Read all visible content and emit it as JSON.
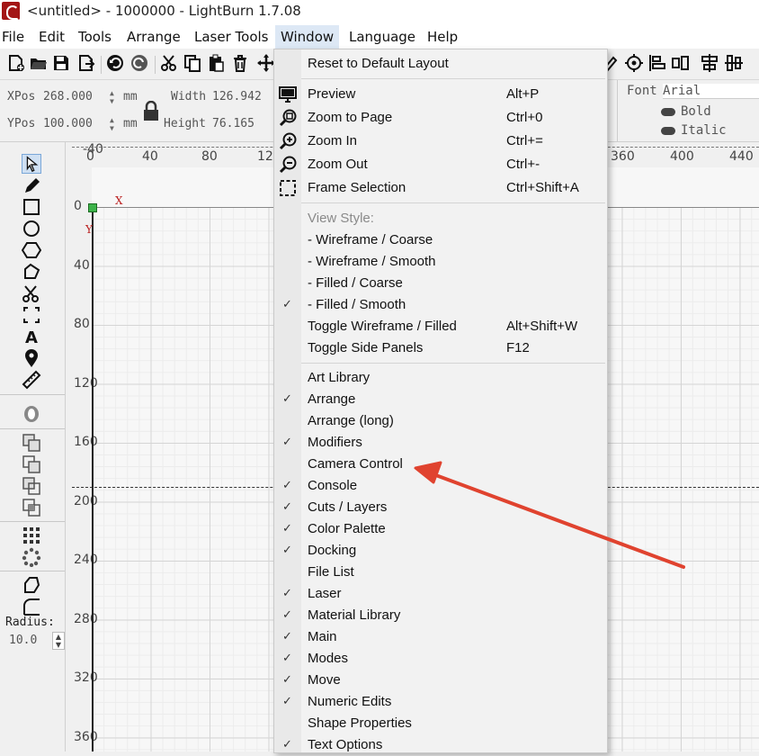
{
  "window": {
    "title": "<untitled> - 1000000 - LightBurn 1.7.08"
  },
  "menubar": [
    {
      "label": "File"
    },
    {
      "label": "Edit"
    },
    {
      "label": "Tools"
    },
    {
      "label": "Arrange"
    },
    {
      "label": "Laser Tools"
    },
    {
      "label": "Window"
    },
    {
      "label": "Language"
    },
    {
      "label": "Help"
    }
  ],
  "numeric": {
    "xpos_label": "XPos",
    "xpos_value": "268.000",
    "xpos_unit": "mm",
    "ypos_label": "YPos",
    "ypos_value": "100.000",
    "ypos_unit": "mm",
    "width_label": "Width",
    "width_value": "126.942",
    "height_label": "Height",
    "height_value": "76.165"
  },
  "font_panel": {
    "font_label": "Font",
    "font_value": "Arial",
    "bold_label": "Bold",
    "italic_label": "Italic"
  },
  "ruler_top": [
    "-40",
    "0",
    "40",
    "80",
    "12",
    "360",
    "400",
    "440"
  ],
  "ruler_left": [
    "0",
    "40",
    "80",
    "120",
    "160",
    "200",
    "240",
    "280",
    "320",
    "360"
  ],
  "axis": {
    "x": "X",
    "y": "Y"
  },
  "radius": {
    "label": "Radius:",
    "value": "10.0"
  },
  "window_menu": {
    "reset": "Reset to Default Layout",
    "preview": {
      "label": "Preview",
      "shortcut": "Alt+P"
    },
    "zoom_page": {
      "label": "Zoom to Page",
      "shortcut": "Ctrl+0"
    },
    "zoom_in": {
      "label": "Zoom In",
      "shortcut": "Ctrl+="
    },
    "zoom_out": {
      "label": "Zoom Out",
      "shortcut": "Ctrl+-"
    },
    "frame_selection": {
      "label": "Frame Selection",
      "shortcut": "Ctrl+Shift+A"
    },
    "view_style_heading": "View Style:",
    "view_styles": [
      {
        "label": "-  Wireframe / Coarse",
        "checked": false
      },
      {
        "label": "-  Wireframe / Smooth",
        "checked": false
      },
      {
        "label": "-  Filled / Coarse",
        "checked": false
      },
      {
        "label": "-  Filled / Smooth",
        "checked": true
      }
    ],
    "toggle_wireframe": {
      "label": "Toggle Wireframe / Filled",
      "shortcut": "Alt+Shift+W"
    },
    "toggle_side": {
      "label": "Toggle Side Panels",
      "shortcut": "F12"
    },
    "panels": [
      {
        "label": "Art Library",
        "checked": false
      },
      {
        "label": "Arrange",
        "checked": true
      },
      {
        "label": "Arrange (long)",
        "checked": false
      },
      {
        "label": "Modifiers",
        "checked": true
      },
      {
        "label": "Camera Control",
        "checked": false
      },
      {
        "label": "Console",
        "checked": true
      },
      {
        "label": "Cuts / Layers",
        "checked": true
      },
      {
        "label": "Color Palette",
        "checked": true
      },
      {
        "label": "Docking",
        "checked": true
      },
      {
        "label": "File List",
        "checked": false
      },
      {
        "label": "Laser",
        "checked": true
      },
      {
        "label": "Material Library",
        "checked": true
      },
      {
        "label": "Main",
        "checked": true
      },
      {
        "label": "Modes",
        "checked": true
      },
      {
        "label": "Move",
        "checked": true
      },
      {
        "label": "Numeric Edits",
        "checked": true
      },
      {
        "label": "Shape Properties",
        "checked": false
      },
      {
        "label": "Text Options",
        "checked": true
      }
    ],
    "check_mark": "✓"
  },
  "annotation": {
    "arrow_color": "#e0432f",
    "target": "Camera Control"
  },
  "colors": {
    "origin": "#3db34a",
    "brand": "#a31515"
  }
}
